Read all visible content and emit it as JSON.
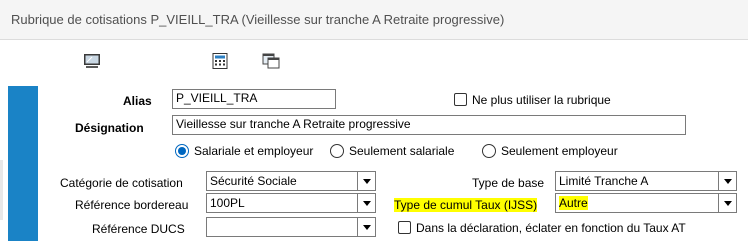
{
  "window": {
    "title": "Rubrique de cotisations P_VIEILL_TRA (Vieillesse sur tranche A Retraite progressive)"
  },
  "toolbar": {
    "icons": [
      "monitor-icon",
      "calculator-icon",
      "windows-icon"
    ]
  },
  "form": {
    "alias_label": "Alias",
    "alias_value": "P_VIEILL_TRA",
    "no_longer_use_label": "Ne plus utiliser la rubrique",
    "designation_label": "Désignation",
    "designation_value": "Vieillesse sur tranche A Retraite progressive",
    "radio_options": [
      {
        "label": "Salariale et employeur",
        "checked": true
      },
      {
        "label": "Seulement salariale",
        "checked": false
      },
      {
        "label": "Seulement employeur",
        "checked": false
      }
    ],
    "categorie_label": "Catégorie de cotisation",
    "categorie_value": "Sécurité Sociale",
    "type_base_label": "Type de base",
    "type_base_value": "Limité Tranche A",
    "ref_bordereau_label": "Référence bordereau",
    "ref_bordereau_value": "100PL",
    "type_cumul_label": "Type de cumul Taux (IJSS)",
    "type_cumul_value": "Autre",
    "ref_ducs_label": "Référence DUCS",
    "ref_ducs_value": "",
    "eclater_label": "Dans la déclaration, éclater en fonction du Taux AT"
  },
  "colors": {
    "accent": "#1a83c6",
    "highlight": "#ffff00",
    "radio": "#0067c0"
  }
}
